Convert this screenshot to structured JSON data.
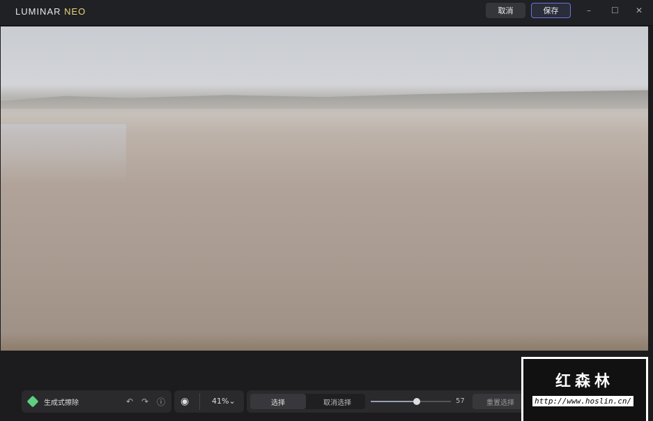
{
  "app": {
    "logo_main": "LUMINAR ",
    "logo_accent": "NEO"
  },
  "titlebar": {
    "cancel": "取消",
    "save": "保存",
    "minimize": "–",
    "maximize": "☐",
    "close": "✕"
  },
  "toolbar": {
    "tool_label": "生成式擦除",
    "undo": "↶",
    "redo": "↷",
    "info": "ⓘ",
    "eye": "◉",
    "zoom": "41%",
    "zoom_caret": "⌄",
    "select": "选择",
    "deselect": "取消选择",
    "brush_size": 57,
    "brush_size_label": "57",
    "brush_size_max": 100,
    "reset_selection": "重置选择"
  },
  "watermark": {
    "title": "红森林",
    "url": "http://www.hoslin.cn/"
  }
}
